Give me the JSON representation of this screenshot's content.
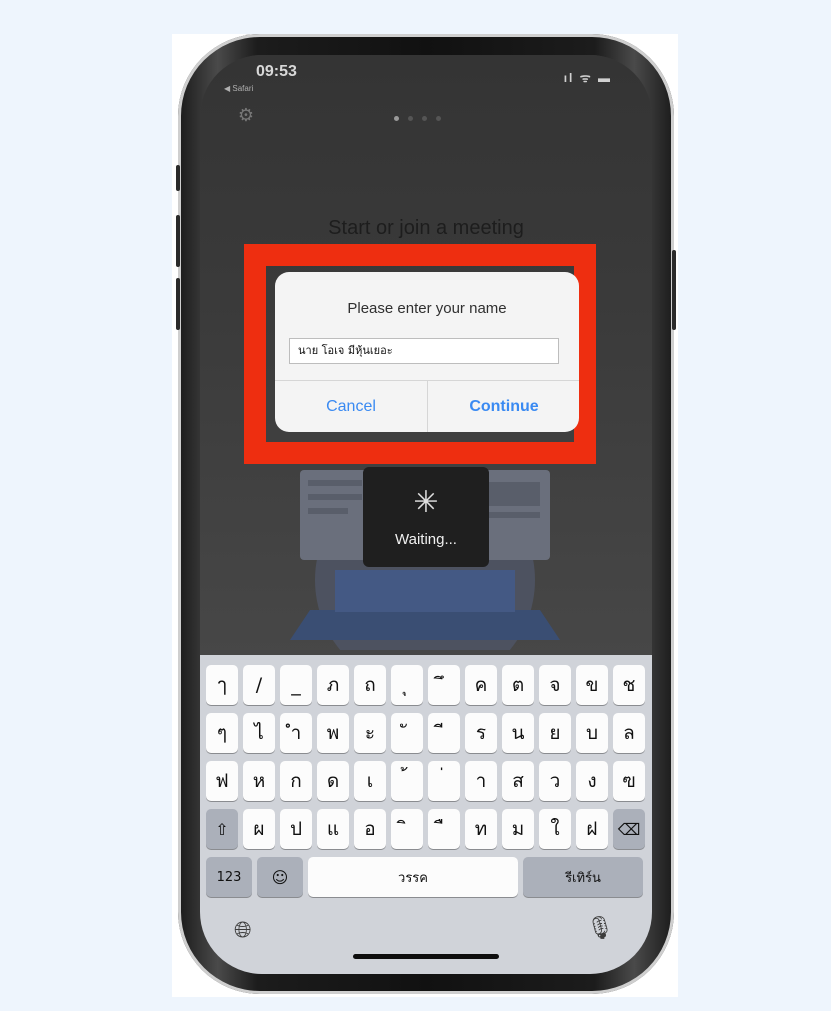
{
  "status_bar": {
    "time": "09:53",
    "back_app": "◀ Safari",
    "icons": "ıl ᯤ ▬"
  },
  "app": {
    "heading": "Start or join a meeting",
    "page_dots": 4
  },
  "dialog": {
    "title": "Please enter your name",
    "input_value": "นาย โอเจ มีหุ้นเยอะ",
    "cancel_label": "Cancel",
    "continue_label": "Continue"
  },
  "waiting": {
    "label": "Waiting..."
  },
  "keyboard": {
    "row1": [
      "ๅ",
      "/",
      "_",
      "ภ",
      "ถ",
      "ุ",
      "ึ",
      "ค",
      "ต",
      "จ",
      "ข",
      "ช"
    ],
    "row2": [
      "ๆ",
      "ไ",
      "ำ",
      "พ",
      "ะ",
      "ั",
      "ี",
      "ร",
      "น",
      "ย",
      "บ",
      "ล"
    ],
    "row3": [
      "ฟ",
      "ห",
      "ก",
      "ด",
      "เ",
      "้",
      "่",
      "า",
      "ส",
      "ว",
      "ง",
      "ฃ"
    ],
    "row4": [
      "ผ",
      "ป",
      "แ",
      "อ",
      "ิ",
      "ื",
      "ท",
      "ม",
      "ใ",
      "ฝ"
    ],
    "numbers_label": "123",
    "space_label": "วรรค",
    "return_label": "รีเทิร์น"
  },
  "icons": {
    "shift": "shift-icon",
    "backspace": "backspace-icon",
    "emoji": "emoji-icon",
    "globe": "globe-icon",
    "mic": "microphone-icon",
    "gear": "gear-icon",
    "spinner": "spinner-icon"
  },
  "colors": {
    "highlight": "#ee2e10",
    "dialog_button": "#3a8af2",
    "keyboard_bg": "#d0d3d9"
  }
}
